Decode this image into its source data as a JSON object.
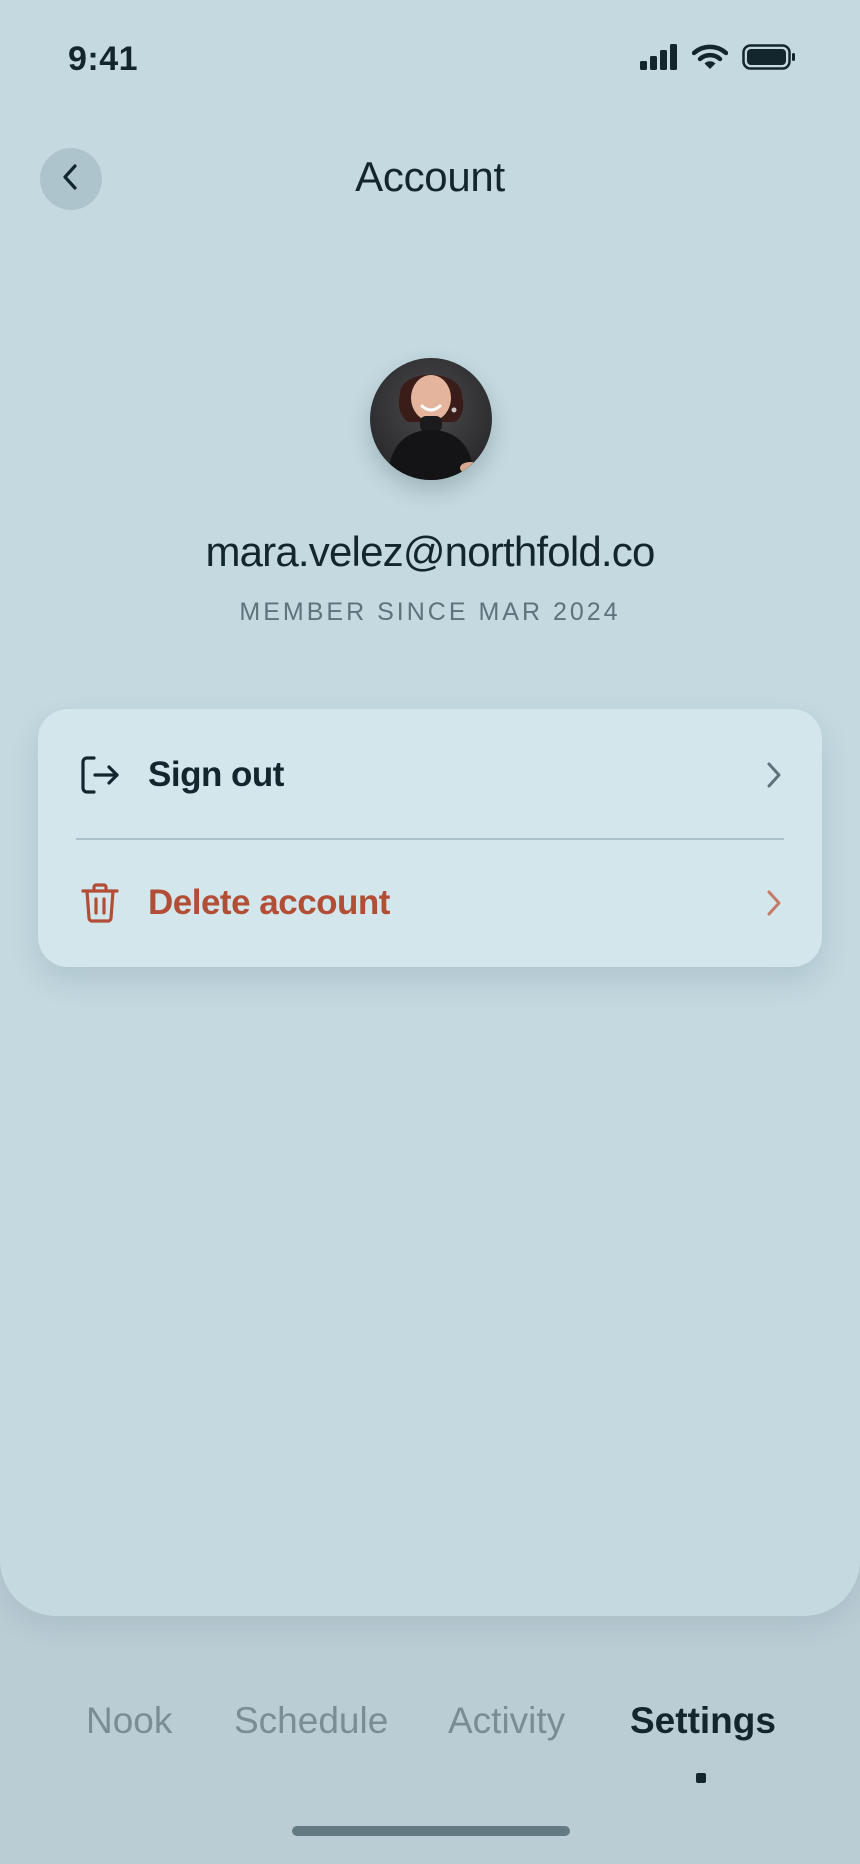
{
  "status_bar": {
    "time": "9:41",
    "icons": [
      "cellular-signal-icon",
      "wifi-icon",
      "battery-icon"
    ]
  },
  "header": {
    "back_icon": "chevron-left-icon",
    "title": "Account"
  },
  "profile": {
    "email": "mara.velez@northfold.co",
    "member_since": "MEMBER SINCE MAR 2024"
  },
  "actions": [
    {
      "label": "Sign out",
      "icon": "sign-out-icon",
      "color": "#14262d"
    },
    {
      "label": "Delete account",
      "icon": "trash-icon",
      "color": "#b24e35"
    }
  ],
  "tabs": [
    {
      "label": "Nook",
      "active": false
    },
    {
      "label": "Schedule",
      "active": false
    },
    {
      "label": "Activity",
      "active": false
    },
    {
      "label": "Settings",
      "active": true
    }
  ],
  "colors": {
    "background": "#c4d9e0",
    "card": "#d2e6ec",
    "text": "#14262d",
    "danger": "#b24e35",
    "muted": "#7a8d94"
  }
}
